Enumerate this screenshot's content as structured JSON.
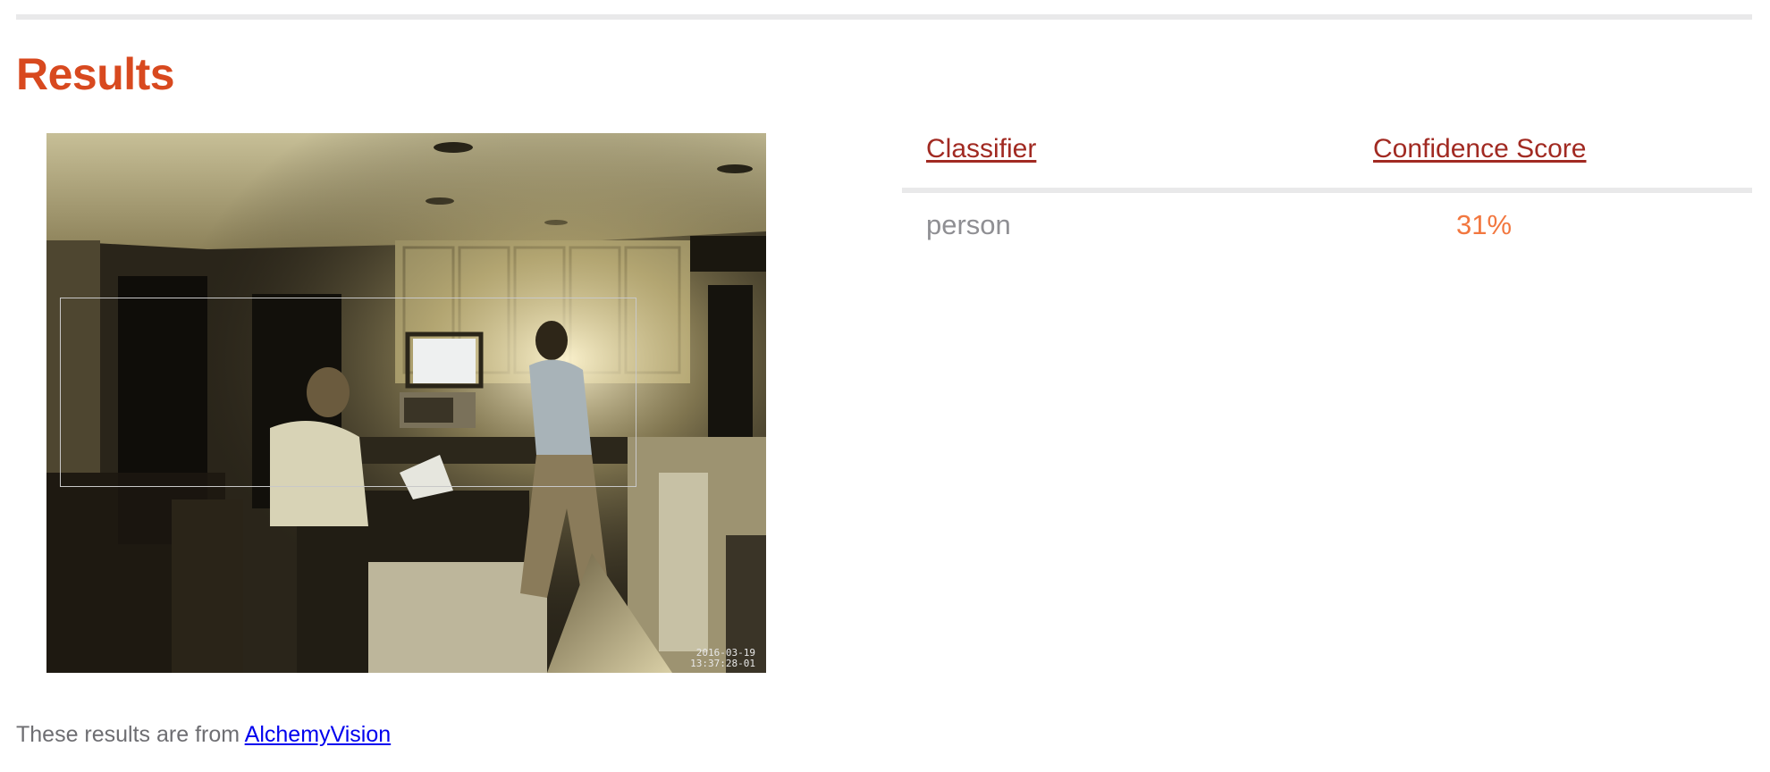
{
  "page": {
    "title": "Results"
  },
  "photo": {
    "timestamp_line1": "2016-03-19",
    "timestamp_line2": "13:37:28-01"
  },
  "table": {
    "headers": {
      "classifier": "Classifier",
      "confidence": "Confidence Score"
    },
    "rows": [
      {
        "classifier": "person",
        "confidence": "31%"
      }
    ]
  },
  "footer": {
    "prefix": "These results are from ",
    "link_text": "AlchemyVision"
  },
  "colors": {
    "title": "#d8491f",
    "header_link": "#a12a22",
    "score": "#f2773f",
    "rule": "#e9e9ea"
  }
}
